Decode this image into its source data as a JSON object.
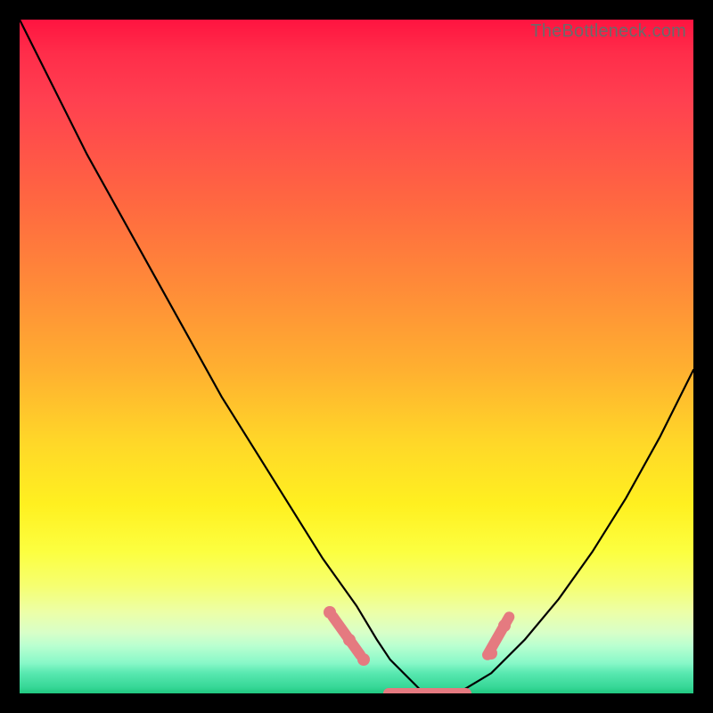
{
  "watermark": "TheBottleneck.com",
  "chart_data": {
    "type": "line",
    "title": "",
    "xlabel": "",
    "ylabel": "",
    "xlim": [
      0,
      100
    ],
    "ylim": [
      0,
      100
    ],
    "grid": false,
    "legend": false,
    "series": [
      {
        "name": "bottleneck-curve",
        "x": [
          0,
          5,
          10,
          15,
          20,
          25,
          30,
          35,
          40,
          45,
          50,
          53,
          55,
          58,
          60,
          63,
          65,
          70,
          75,
          80,
          85,
          90,
          95,
          100
        ],
        "y": [
          100,
          90,
          80,
          71,
          62,
          53,
          44,
          36,
          28,
          20,
          13,
          8,
          5,
          2,
          0,
          0,
          0,
          3,
          8,
          14,
          21,
          29,
          38,
          48
        ]
      }
    ],
    "markers": {
      "name": "highlight-points",
      "color": "#e57a80",
      "points": [
        {
          "x": 46,
          "y": 12
        },
        {
          "x": 49,
          "y": 8
        },
        {
          "x": 51,
          "y": 5
        },
        {
          "x": 70,
          "y": 6
        },
        {
          "x": 72,
          "y": 10
        }
      ],
      "flat_segment": {
        "x_start": 54,
        "x_end": 67,
        "y": 0
      }
    },
    "background_gradient": {
      "top": "#ff1440",
      "mid": "#ffd828",
      "bottom": "#20c880"
    }
  }
}
